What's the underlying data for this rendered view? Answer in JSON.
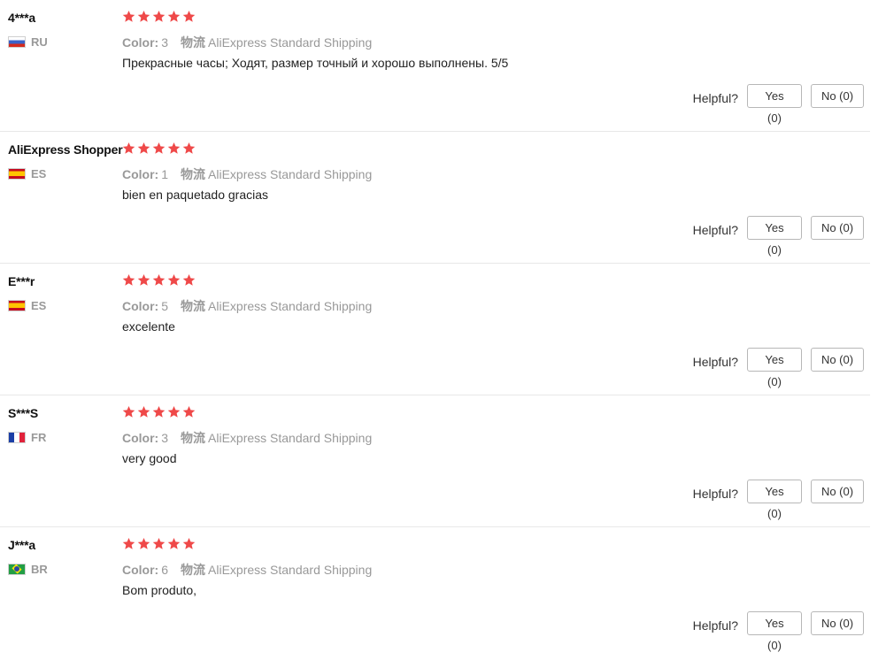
{
  "helpful_label": "Helpful?",
  "colors": {
    "star": "#ef4949",
    "muted": "#999999",
    "divider": "#e8e8e8"
  },
  "reviews": [
    {
      "user": "4***a",
      "country_code": "RU",
      "flag_icon": "russia-flag-icon",
      "rating": 5,
      "color_label": "Color:",
      "color_value": "3",
      "shipping_label": "物流",
      "shipping_value": "AliExpress Standard Shipping",
      "text": "Прекрасные часы; Ходят, размер точный и хорошо выполнены. 5/5",
      "yes_label": "Yes (0)",
      "no_label": "No (0)"
    },
    {
      "user": "AliExpress Shopper",
      "country_code": "ES",
      "flag_icon": "spain-flag-icon",
      "rating": 5,
      "color_label": "Color:",
      "color_value": "1",
      "shipping_label": "物流",
      "shipping_value": "AliExpress Standard Shipping",
      "text": "bien en paquetado gracias",
      "yes_label": "Yes (0)",
      "no_label": "No (0)"
    },
    {
      "user": "E***r",
      "country_code": "ES",
      "flag_icon": "spain-flag-icon",
      "rating": 5,
      "color_label": "Color:",
      "color_value": "5",
      "shipping_label": "物流",
      "shipping_value": "AliExpress Standard Shipping",
      "text": "excelente",
      "yes_label": "Yes (0)",
      "no_label": "No (0)"
    },
    {
      "user": "S***S",
      "country_code": "FR",
      "flag_icon": "france-flag-icon",
      "rating": 5,
      "color_label": "Color:",
      "color_value": "3",
      "shipping_label": "物流",
      "shipping_value": "AliExpress Standard Shipping",
      "text": "very good",
      "yes_label": "Yes (0)",
      "no_label": "No (0)"
    },
    {
      "user": "J***a",
      "country_code": "BR",
      "flag_icon": "brazil-flag-icon",
      "rating": 5,
      "color_label": "Color:",
      "color_value": "6",
      "shipping_label": "物流",
      "shipping_value": "AliExpress Standard Shipping",
      "text": "Bom produto,",
      "yes_label": "Yes (0)",
      "no_label": "No (0)"
    }
  ]
}
